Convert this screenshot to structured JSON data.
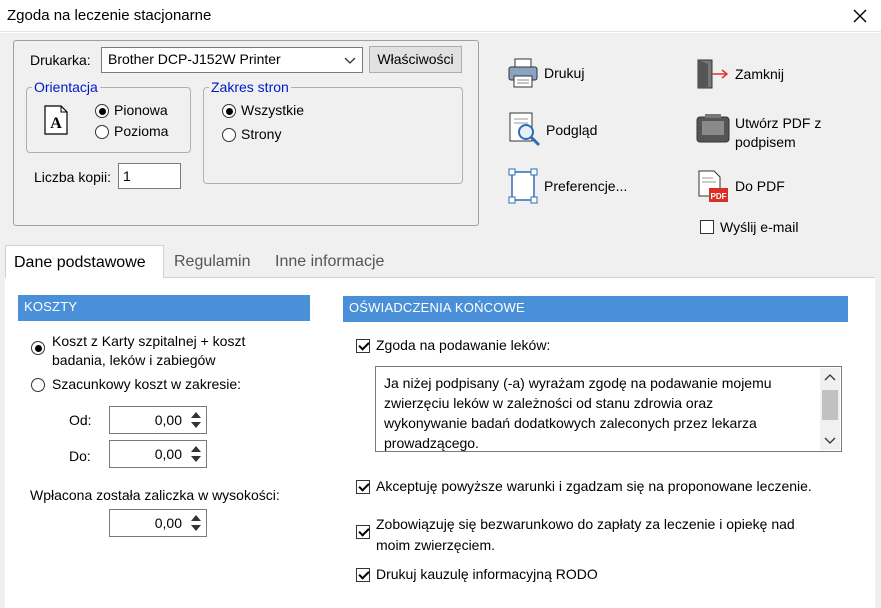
{
  "window": {
    "title": "Zgoda na leczenie stacjonarne"
  },
  "print": {
    "printer_label": "Drukarka:",
    "printer_value": "Brother DCP-J152W Printer",
    "properties_label": "Właściwości",
    "orientation": {
      "title": "Orientacja",
      "portrait": "Pionowa",
      "landscape": "Pozioma"
    },
    "pages": {
      "title": "Zakres stron",
      "all": "Wszystkie",
      "range": "Strony"
    },
    "copies_label": "Liczba kopii:",
    "copies_value": "1"
  },
  "actions": {
    "print": "Drukuj",
    "preview": "Podgląd",
    "preferences": "Preferencje...",
    "close": "Zamknij",
    "pdf_sign_line1": "Utwórz PDF z",
    "pdf_sign_line2": "podpisem",
    "to_pdf": "Do PDF",
    "send_email": "Wyślij e-mail"
  },
  "tabs": [
    "Dane podstawowe",
    "Regulamin",
    "Inne informacje"
  ],
  "costs": {
    "header": "KOSZTY",
    "option1_line1": "Koszt z Karty szpitalnej + koszt",
    "option1_line2": "badania, leków i zabiegów",
    "option2": "Szacunkowy koszt w zakresie:",
    "from_label": "Od:",
    "from_value": "0,00",
    "to_label": "Do:",
    "to_value": "0,00",
    "deposit_label": "Wpłacona została zaliczka w wysokości:",
    "deposit_value": "0,00"
  },
  "statements": {
    "header": "OŚWIADCZENIA KOŃCOWE",
    "medication_consent": "Zgoda na podawanie leków:",
    "consent_text_line1": "Ja niżej podpisany (-a) wyrażam zgodę na podawanie mojemu",
    "consent_text_line2": "zwierzęciu leków w zależności od stanu zdrowia oraz",
    "consent_text_line3": "wykonywanie badań dodatkowych zaleconych przez lekarza",
    "consent_text_line4": "prowadzącego.",
    "accept_terms": "Akceptuję powyższe warunki i zgadzam się na proponowane leczenie.",
    "payment_line1": "Zobowiązuję się bezwarunkowo do zapłaty za leczenie i opiekę nad",
    "payment_line2": "moim zwierzęciem.",
    "print_rodo": "Drukuj kauzulę informacyjną RODO"
  }
}
